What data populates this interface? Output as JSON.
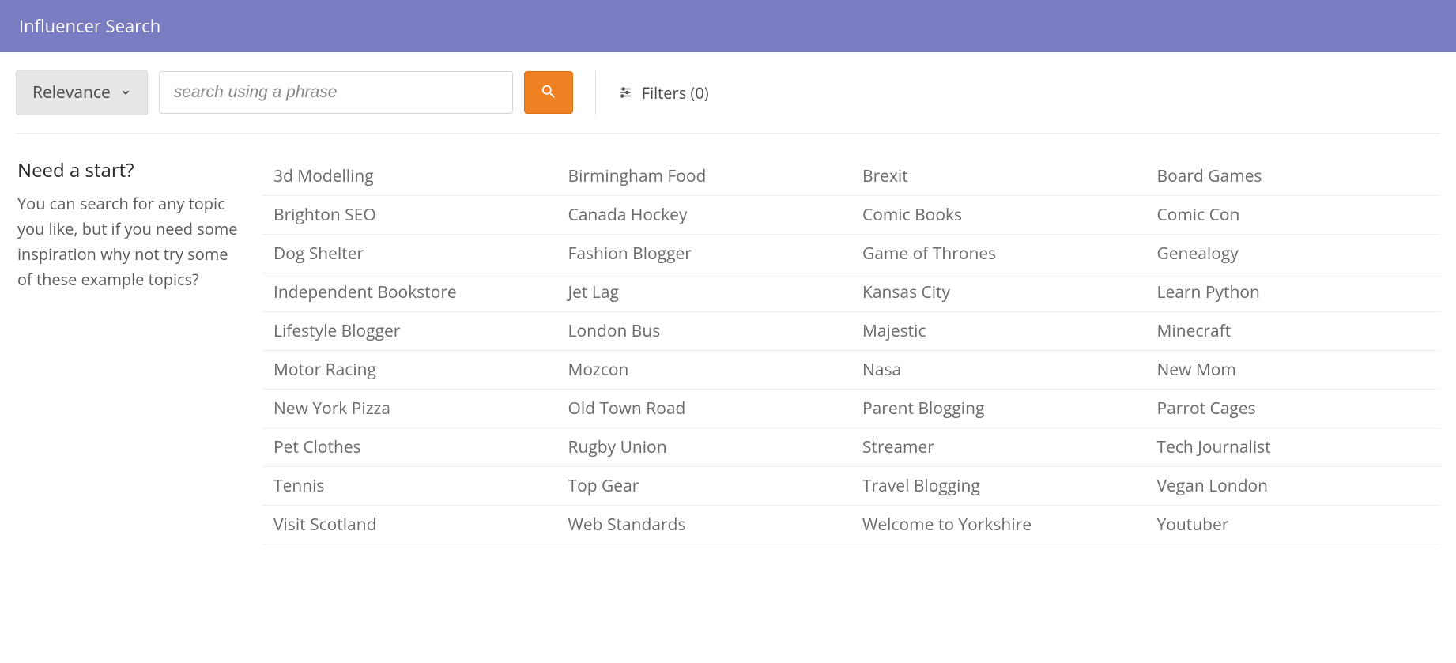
{
  "header": {
    "title": "Influencer Search"
  },
  "controls": {
    "sort_label": "Relevance",
    "search_placeholder": "search using a phrase",
    "filters_label": "Filters (0)"
  },
  "sidebar": {
    "heading": "Need a start?",
    "description": "You can search for any topic you like, but if you need some inspiration why not try some of these example topics?"
  },
  "topics": [
    "3d Modelling",
    "Birmingham Food",
    "Brexit",
    "Board Games",
    "Brighton SEO",
    "Canada Hockey",
    "Comic Books",
    "Comic Con",
    "Dog Shelter",
    "Fashion Blogger",
    "Game of Thrones",
    "Genealogy",
    "Independent Bookstore",
    "Jet Lag",
    "Kansas City",
    "Learn Python",
    "Lifestyle Blogger",
    "London Bus",
    "Majestic",
    "Minecraft",
    "Motor Racing",
    "Mozcon",
    "Nasa",
    "New Mom",
    "New York Pizza",
    "Old Town Road",
    "Parent Blogging",
    "Parrot Cages",
    "Pet Clothes",
    "Rugby Union",
    "Streamer",
    "Tech Journalist",
    "Tennis",
    "Top Gear",
    "Travel Blogging",
    "Vegan London",
    "Visit Scotland",
    "Web Standards",
    "Welcome to Yorkshire",
    "Youtuber"
  ]
}
